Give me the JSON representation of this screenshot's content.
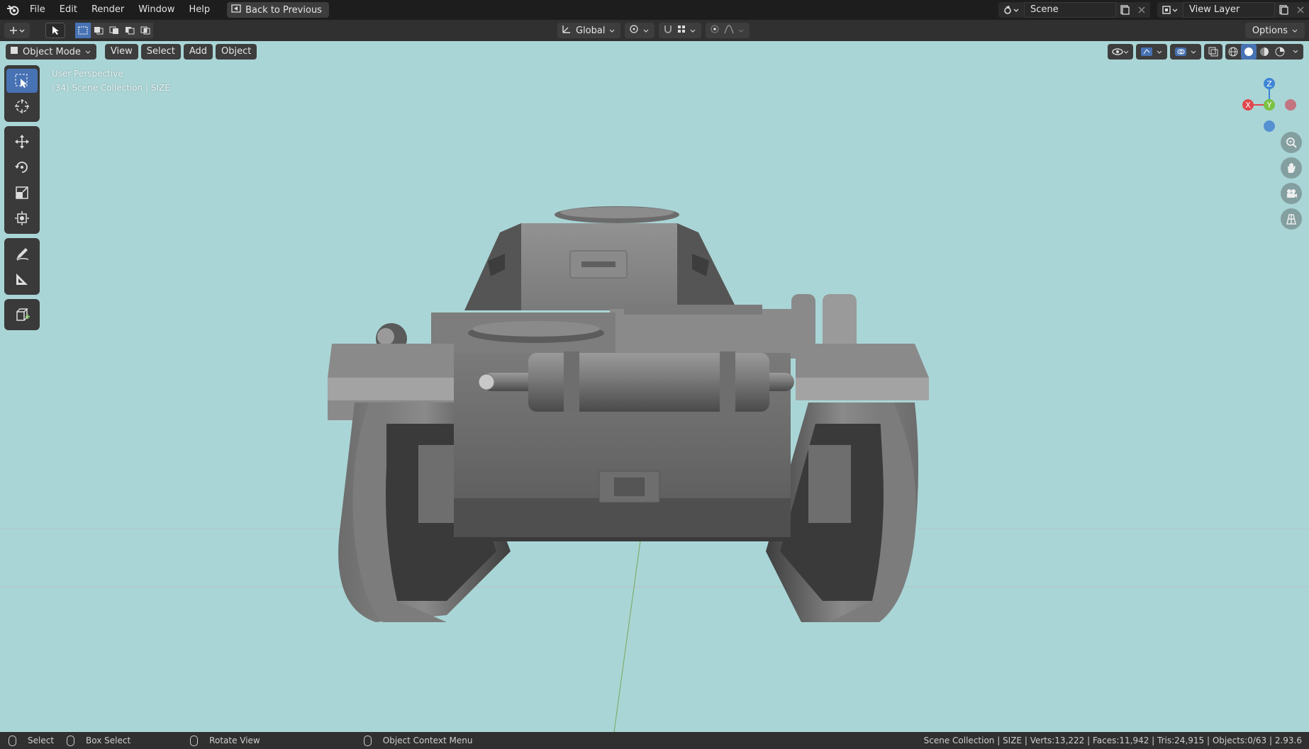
{
  "menu": {
    "items": [
      "File",
      "Edit",
      "Render",
      "Window",
      "Help"
    ],
    "back_label": "Back to Previous"
  },
  "top_right": {
    "scene_name": "Scene",
    "view_layer_name": "View Layer"
  },
  "tool_header": {
    "orientation": "Global",
    "options_label": "Options"
  },
  "viewport_header": {
    "mode": "Object Mode",
    "menus": [
      "View",
      "Select",
      "Add",
      "Object"
    ]
  },
  "overlay": {
    "perspective": "User Perspective",
    "collection": "(34) Scene Collection | SIZE"
  },
  "gizmo": {
    "z_label": "Z",
    "y_label": "Y",
    "x_label": "X",
    "x_color": "#e0474f",
    "y_color": "#7ac144",
    "z_color": "#3f86d5"
  },
  "toolbar_icons": [
    "select-box-icon",
    "cursor-icon",
    "move-icon",
    "rotate-icon",
    "scale-icon",
    "transform-icon",
    "annotate-icon",
    "measure-icon",
    "add-cube-icon"
  ],
  "status": {
    "select": "Select",
    "box_select": "Box Select",
    "rotate_view": "Rotate View",
    "context_menu": "Object Context Menu",
    "stats": "Scene Collection | SIZE | Verts:13,222 | Faces:11,942 | Tris:24,915 | Objects:0/63 | 2.93.6"
  },
  "colors": {
    "viewport_bg": "#aad5d6",
    "accent": "#4772b3",
    "header_bg": "#303030"
  }
}
